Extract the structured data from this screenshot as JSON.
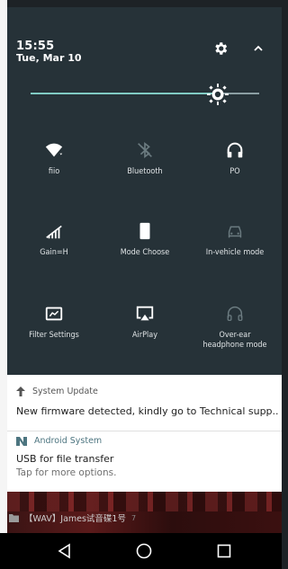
{
  "status": {
    "time": "15:55",
    "date": "Tue, Mar 10"
  },
  "brightness": {
    "level": 0.82
  },
  "tiles": [
    {
      "label": "fiio",
      "icon": "wifi-icon",
      "dim": false
    },
    {
      "label": "Bluetooth",
      "icon": "bluetooth-off-icon",
      "dim": true
    },
    {
      "label": "PO",
      "icon": "headphones-icon",
      "dim": false
    },
    {
      "label": "Gain=H",
      "icon": "gain-icon",
      "dim": false
    },
    {
      "label": "Mode Choose",
      "icon": "phone-mode-icon",
      "dim": false
    },
    {
      "label": "In-vehicle mode",
      "icon": "car-icon",
      "dim": true
    },
    {
      "label": "Filter Settings",
      "icon": "filter-icon",
      "dim": false
    },
    {
      "label": "AirPlay",
      "icon": "airplay-icon",
      "dim": false
    },
    {
      "label": "Over-ear\nheadphone mode",
      "icon": "over-ear-icon",
      "dim": true
    }
  ],
  "notifications": [
    {
      "app": "System Update",
      "icon": "arrow-up-icon",
      "text": "New firmware detected, kindly go to Technical supp.."
    },
    {
      "app": "Android System",
      "icon": "android-icon",
      "title": "USB for file transfer",
      "sub": "Tap for more options."
    }
  ],
  "media": {
    "text": "【WAV】James试音碟1号",
    "count": "7"
  },
  "colors": {
    "shade": "#263238",
    "accent": "#80cbc4"
  }
}
